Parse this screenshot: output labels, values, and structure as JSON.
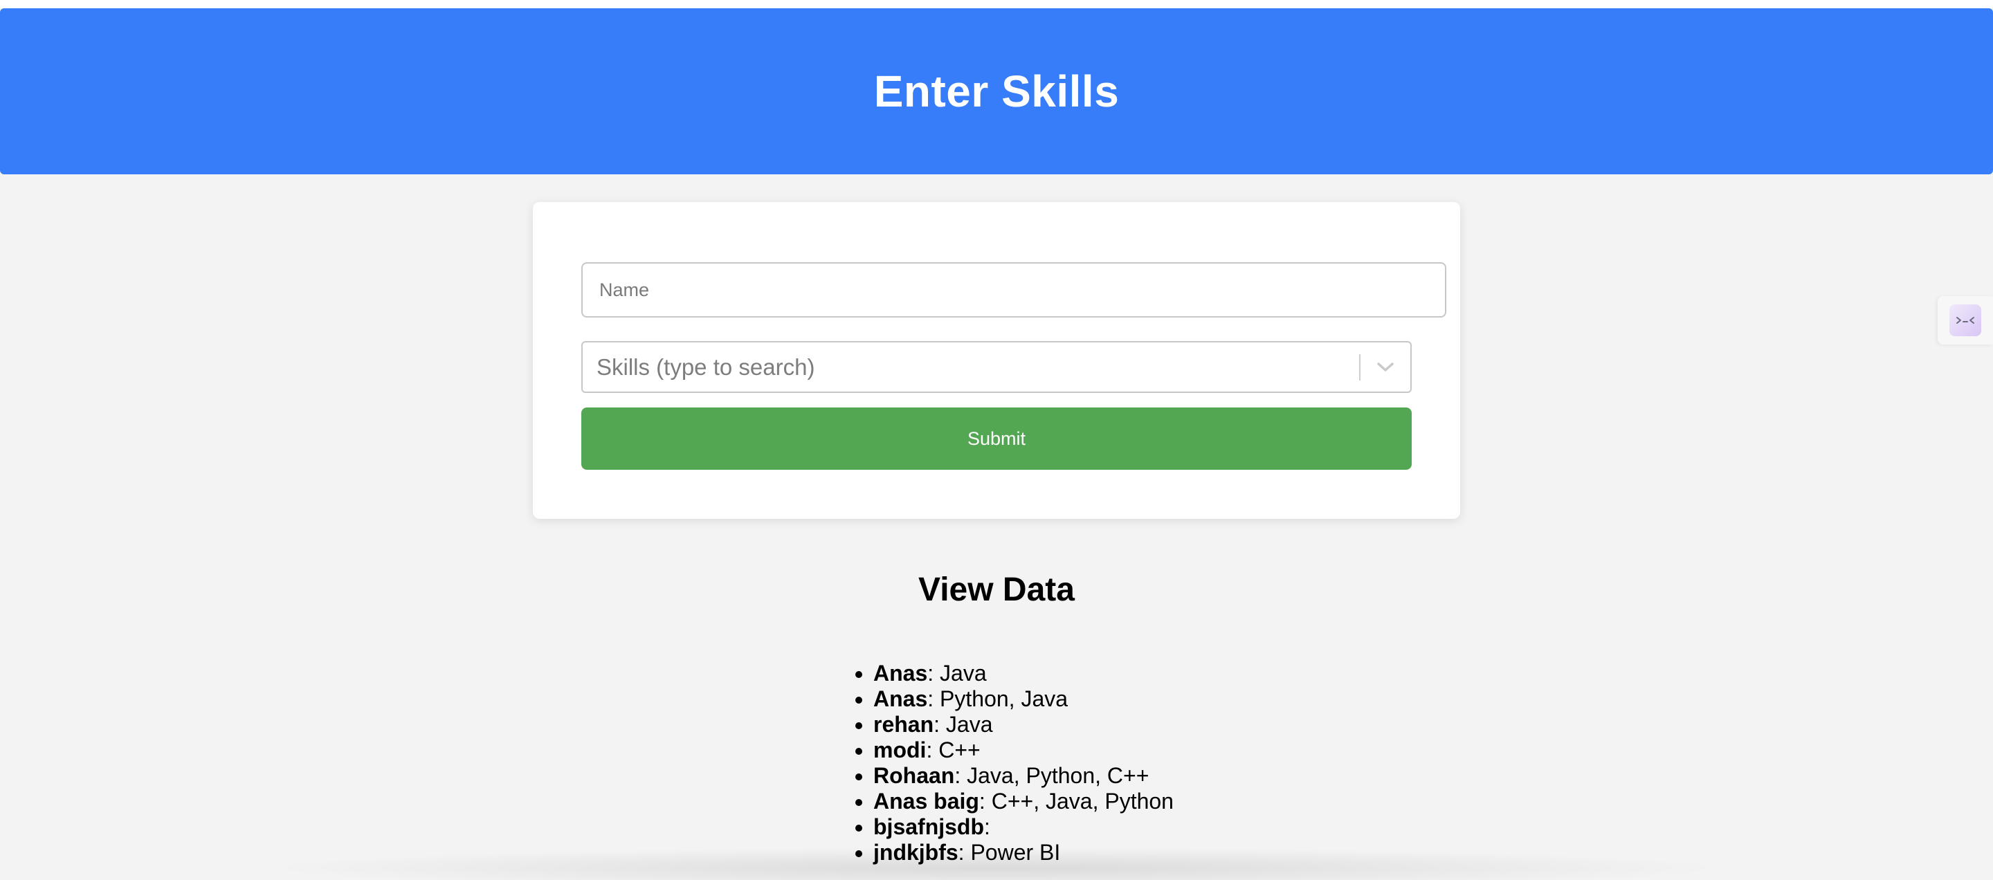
{
  "header": {
    "title": "Enter Skills",
    "color": "#377cf8"
  },
  "form": {
    "name_placeholder": "Name",
    "name_value": "",
    "skills_placeholder": "Skills (type to search)",
    "submit_label": "Submit",
    "submit_color": "#53a753"
  },
  "view": {
    "title": "View Data",
    "entries": [
      {
        "name": "Anas",
        "skills": ": Java"
      },
      {
        "name": "Anas",
        "skills": ": Python, Java"
      },
      {
        "name": "rehan",
        "skills": ": Java"
      },
      {
        "name": "modi",
        "skills": ": C++"
      },
      {
        "name": "Rohaan",
        "skills": ": Java, Python, C++"
      },
      {
        "name": "Anas baig",
        "skills": ": C++, Java, Python"
      },
      {
        "name": "bjsafnjsdb",
        "skills": ":"
      },
      {
        "name": "jndkjbfs",
        "skills": ": Power BI"
      }
    ]
  },
  "icons": {
    "dropdown": "chevron-down-icon",
    "side_widget": "assistant-face-icon"
  }
}
